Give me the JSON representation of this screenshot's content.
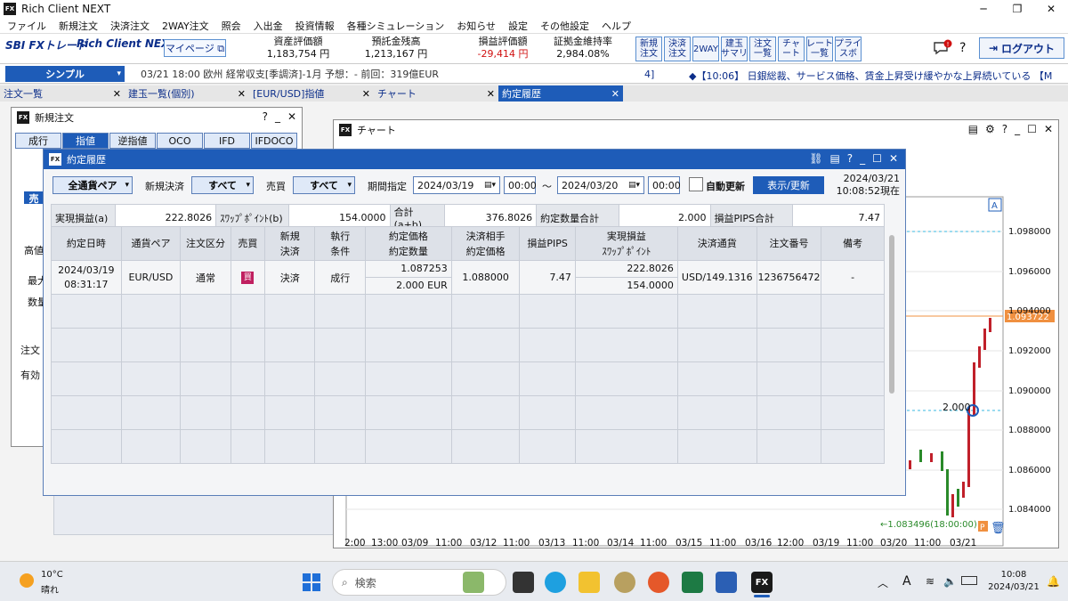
{
  "app": {
    "title": "Rich Client NEXT",
    "logo": "FX",
    "controls": {
      "minimize": "─",
      "maximize": "❐",
      "close": "✕"
    }
  },
  "menu": [
    "ファイル",
    "新規注文",
    "決済注文",
    "2WAY注文",
    "照会",
    "入出金",
    "投資情報",
    "各種シミュレーション",
    "お知らせ",
    "設定",
    "その他設定",
    "ヘルプ"
  ],
  "brand": {
    "sbi": "SBI FXトレード",
    "product": "Rich Client NEXT",
    "mypage": "マイページ ⧉"
  },
  "stats": [
    {
      "label": "資産評価額",
      "value": "1,183,754 円",
      "color": "#111111"
    },
    {
      "label": "預託金残高",
      "value": "1,213,167 円",
      "color": "#111111"
    },
    {
      "label": "損益評価額",
      "value": "-29,414 円",
      "color": "#d01010"
    },
    {
      "label": "証拠金維持率",
      "value": "2,984.08%",
      "color": "#111111"
    }
  ],
  "quick_buttons": [
    "新規\n注文",
    "決済\n注文",
    "2WAY",
    "建玉\nサマリ",
    "注文\n一覧",
    "チャ\nート",
    "レート\n一覧",
    "プライ\nスボ"
  ],
  "logout": "ログアウト",
  "news": {
    "mode": "シンプル",
    "item": "03/21 18:00 欧州 経常収支[季調済]-1月 予想：- 前回：319億EUR",
    "counter": "4]",
    "headline": "◆【10:06】 日銀総裁、サービス価格、賃金上昇受け緩やかな上昇続いている 【M"
  },
  "tabs": [
    {
      "label": "注文一覧",
      "active": false
    },
    {
      "label": "建玉一覧(個別)",
      "active": false
    },
    {
      "label": "[EUR/USD]指値",
      "active": false
    },
    {
      "label": "チャート",
      "active": false
    },
    {
      "label": "約定履歴",
      "active": true
    }
  ],
  "new_order": {
    "title": "新規注文",
    "tabs": [
      "成行",
      "指値",
      "逆指値",
      "OCO",
      "IFD",
      "IFDOCO"
    ],
    "side_label": "売",
    "labels": [
      "高値",
      "最大",
      "数量",
      "注文",
      "有効"
    ]
  },
  "chart": {
    "title": "チャート",
    "y_ticks": [
      "1.098000",
      "1.096000",
      "1.094000",
      "1.092000",
      "1.090000",
      "1.088000",
      "1.086000",
      "1.084000"
    ],
    "x_ticks": [
      "2:00",
      "13:00",
      "03/09",
      "11:00",
      "03/12",
      "11:00",
      "03/13",
      "11:00",
      "03/14",
      "11:00",
      "03/15",
      "11:00",
      "03/16",
      "12:00",
      "03/19",
      "11:00",
      "03/20",
      "11:00",
      "03/21"
    ],
    "current_price": "1.093722",
    "position_label": "2.000",
    "low_label": "←1.083496(18:00:00)"
  },
  "history": {
    "title": "約定履歴",
    "pair_filter": "全通貨ペア",
    "new_settle_label": "新規決済",
    "new_settle_value": "すべて",
    "side_label": "売買",
    "side_value": "すべて",
    "period_label": "期間指定",
    "date_from": "2024/03/19",
    "time_from": "00:00",
    "tilde": "～",
    "date_to": "2024/03/20",
    "time_to": "00:00",
    "auto_update": "自動更新",
    "show_button": "表示/更新",
    "as_of_date": "2024/03/21",
    "as_of_time": "10:08:52現在",
    "summary": [
      {
        "label": "実現損益(a)",
        "value": "222.8026"
      },
      {
        "label": "ｽﾜｯﾌﾟﾎﾟｲﾝﾄ(b)",
        "value": "154.0000"
      },
      {
        "label": "合計(a+b)",
        "value": "376.8026"
      },
      {
        "label": "約定数量合計",
        "value": "2.000"
      },
      {
        "label": "損益PIPS合計",
        "value": "7.47"
      }
    ],
    "columns": [
      "約定日時",
      "通貨ペア",
      "注文区分",
      "売買",
      "新規\n決済",
      "執行\n条件",
      "約定価格\n約定数量",
      "決済相手\n約定価格",
      "損益PIPS",
      "実現損益\nｽﾜｯﾌﾟﾎﾟｲﾝﾄ",
      "決済通貨",
      "注文番号",
      "備考"
    ],
    "rows": [
      {
        "date": "2024/03/19",
        "time": "08:31:17",
        "pair": "EUR/USD",
        "type": "通常",
        "side": "買",
        "new_settle": "決済",
        "condition": "成行",
        "price": "1.087253",
        "qty": "2.000 EUR",
        "settle_price": "1.088000",
        "pips": "7.47",
        "pnl": "222.8026",
        "swap": "154.0000",
        "currency": "USD/149.1316",
        "order_no": "1236756472",
        "note": "-"
      }
    ]
  },
  "taskbar": {
    "weather_temp": "10°C",
    "weather_text": "晴れ",
    "search": "検索",
    "ime": "A",
    "time": "10:08",
    "date": "2024/03/21"
  }
}
